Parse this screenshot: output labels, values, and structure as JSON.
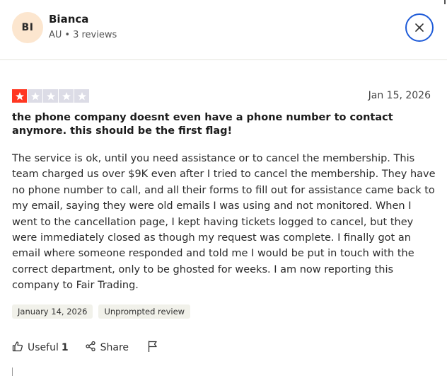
{
  "reviewer": {
    "initials": "BI",
    "name": "Bianca",
    "country": "AU",
    "separator": "•",
    "reviews_count": "3 reviews"
  },
  "review": {
    "rating": 1,
    "max_rating": 5,
    "date": "Jan 15, 2026",
    "title": "the phone company doesnt even have a phone number to contact anymore. this should be the first flag!",
    "body": "The service is ok, until you need assistance or to cancel the membership. This team charged us over $9K even after I tried to cancel the membership. They have no phone number to call, and all their forms to fill out for assistance came back to my email, saying they were old emails I was using and not monitored. When I went to the cancellation page, I kept having tickets logged to cancel, but they were immediately closed as though my request was complete. I finally got an email where someone responded and told me I would be put in touch with the correct department, only to be ghosted for weeks. I am now reporting this company to Fair Trading.",
    "tags": [
      "January 14, 2026",
      "Unprompted review"
    ]
  },
  "actions": {
    "useful_label": "Useful",
    "useful_count": "1",
    "share_label": "Share"
  },
  "icons": {
    "close": "close-icon",
    "thumbs_up": "thumbs-up-icon",
    "share": "share-icon",
    "flag": "flag-icon",
    "star": "star-icon"
  },
  "colors": {
    "star_filled": "#ff3722",
    "star_empty": "#dcdce6",
    "accent": "#1e5bd8",
    "avatar_bg": "#fce6cf"
  }
}
